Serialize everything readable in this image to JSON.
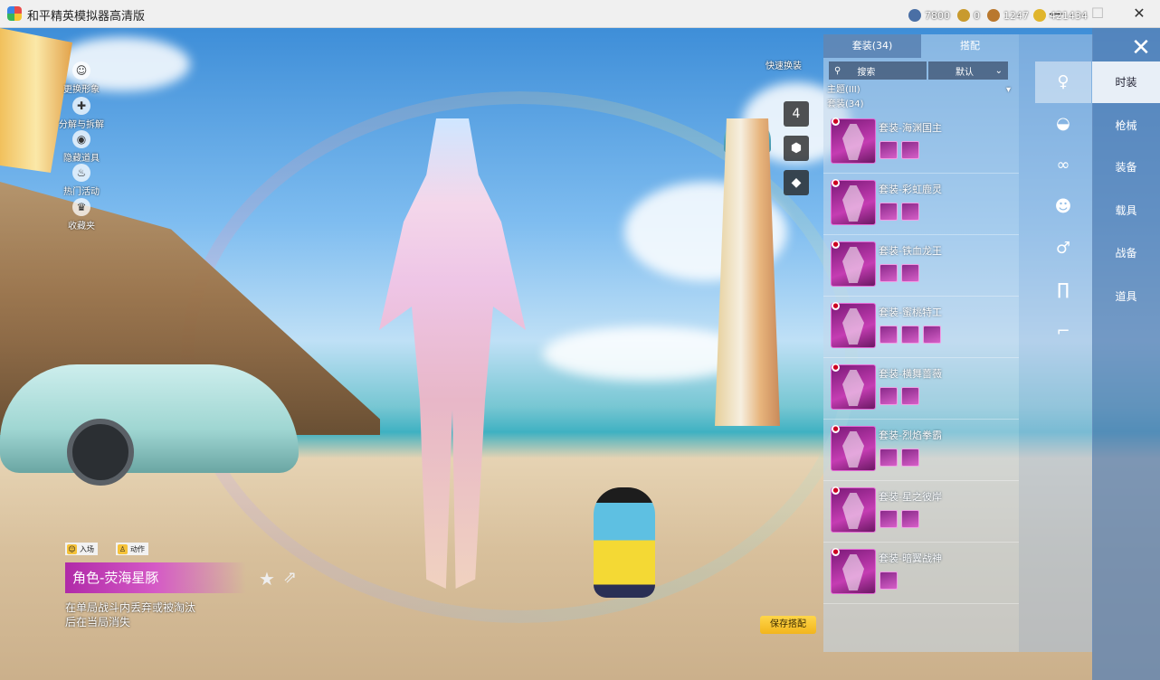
{
  "window": {
    "title": "和平精英模拟器高清版",
    "min": "—",
    "max": "☐",
    "close": "✕"
  },
  "left_menu": [
    {
      "label": "更换形象",
      "icon": "person-icon"
    },
    {
      "label": "分解与拆解",
      "icon": "dismantle-icon"
    },
    {
      "label": "隐藏道具",
      "icon": "eye-icon"
    },
    {
      "label": "热门活动",
      "icon": "flame-icon"
    },
    {
      "label": "收藏夹",
      "icon": "crown-icon"
    }
  ],
  "currency": [
    {
      "value": "7800",
      "color": "#4a6fa5"
    },
    {
      "value": "0",
      "color": "#c89a2e"
    },
    {
      "value": "1247",
      "color": "#b9782e"
    },
    {
      "value": "421434",
      "color": "#e0b52c"
    }
  ],
  "quick_swap": {
    "label": "快速换装",
    "slot_number": "4"
  },
  "panel": {
    "tabs": [
      "套装(34)",
      "搭配"
    ],
    "search": "搜索",
    "sort": "默认",
    "theme_label": "主题(III)",
    "count_label": "套装(34)",
    "items": [
      {
        "name": "套装-海渊国主",
        "minis": 2
      },
      {
        "name": "套装-彩虹鹿灵",
        "minis": 2
      },
      {
        "name": "套装-铁血龙王",
        "minis": 2
      },
      {
        "name": "套装-蜜桃特工",
        "minis": 3
      },
      {
        "name": "套装-横舞蔷薇",
        "minis": 2
      },
      {
        "name": "套装-烈焰拳霸",
        "minis": 2
      },
      {
        "name": "套装-星之彼岸",
        "minis": 2
      },
      {
        "name": "套装-暗翼战神",
        "minis": 1
      }
    ]
  },
  "rail_icons": [
    "body-icon",
    "cap-icon",
    "glasses-icon",
    "mask-icon",
    "top-icon",
    "pants-icon",
    "shoes-icon"
  ],
  "categories": [
    "时装",
    "枪械",
    "装备",
    "载具",
    "战备",
    "道具"
  ],
  "character": {
    "tab_enter": "入场",
    "tab_action": "动作",
    "name": "角色-荧海星豚",
    "description": "在单局战斗内丢弃或被淘汰后在当局消失"
  },
  "save_button": "保存搭配"
}
